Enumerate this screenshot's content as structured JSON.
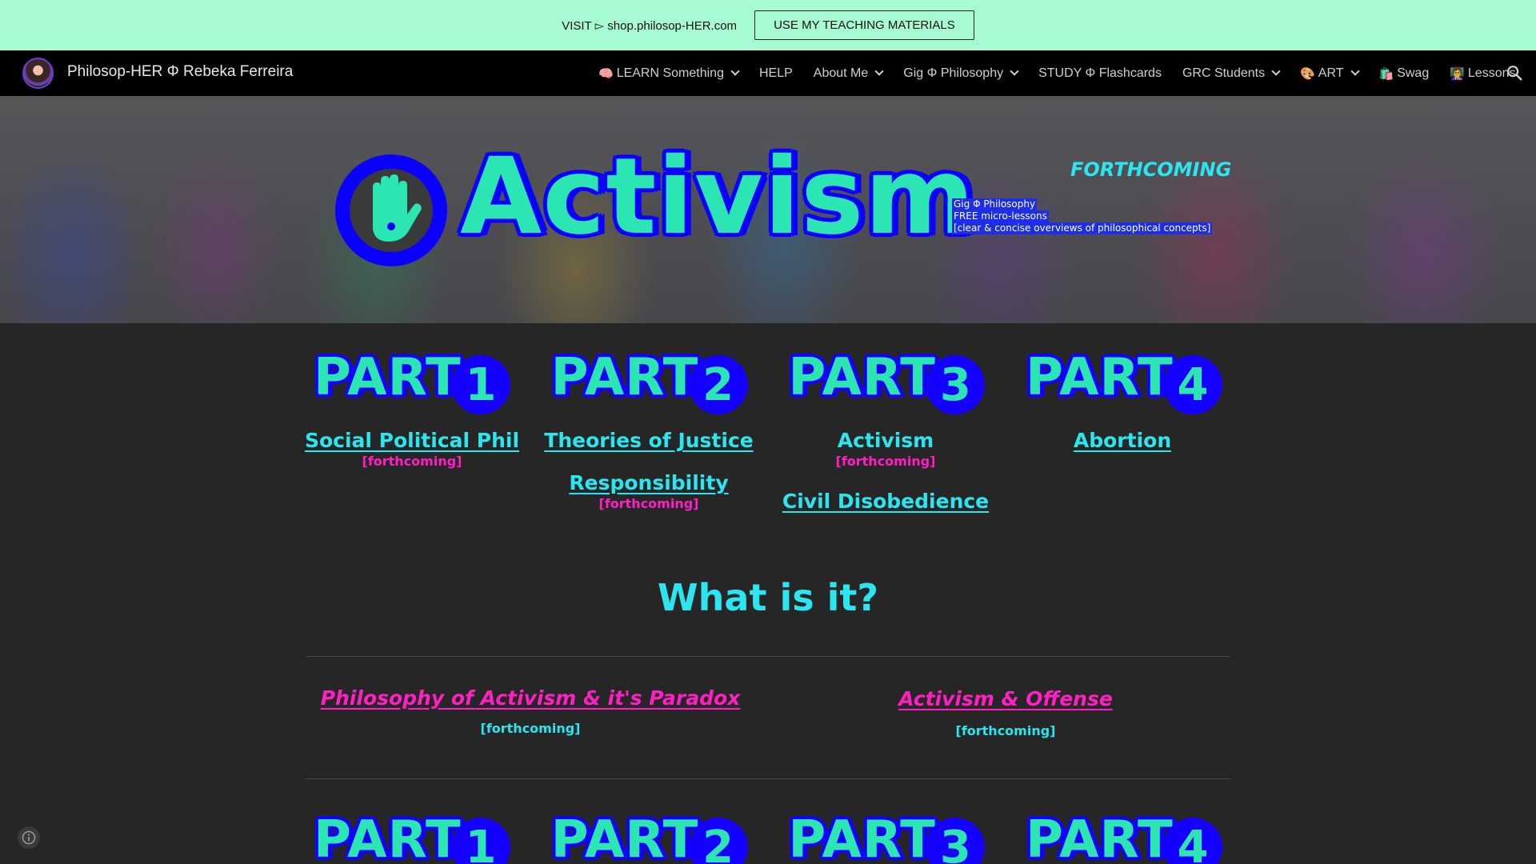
{
  "promo": {
    "text": "VISIT ▻ shop.philosop-HER.com",
    "button_label": "USE MY TEACHING MATERIALS"
  },
  "nav": {
    "site_title": "Philosop-HER Φ Rebeka Ferreira",
    "items": [
      {
        "emoji": "🧠",
        "label": "LEARN Something",
        "dropdown": true
      },
      {
        "emoji": "",
        "label": "HELP",
        "dropdown": false
      },
      {
        "emoji": "",
        "label": "About Me",
        "dropdown": true
      },
      {
        "emoji": "",
        "label": "Gig Φ Philosophy",
        "dropdown": true
      },
      {
        "emoji": "",
        "label": "STUDY Φ Flashcards",
        "dropdown": false
      },
      {
        "emoji": "",
        "label": "GRC Students",
        "dropdown": true
      },
      {
        "emoji": "🎨",
        "label": "ART",
        "dropdown": true
      },
      {
        "emoji": "🛍️",
        "label": "Swag",
        "dropdown": false
      },
      {
        "emoji": "👩‍🏫",
        "label": "Lessons",
        "dropdown": false
      }
    ]
  },
  "hero": {
    "title": "Activism",
    "forthcoming": "FORTHCOMING",
    "desc_line1": "Gig Φ Philosophy",
    "desc_line2": "FREE micro-lessons",
    "desc_line3": "[clear & concise overviews of philosophical concepts]"
  },
  "parts": {
    "word": "PART",
    "numbers": [
      "1",
      "2",
      "3",
      "4"
    ]
  },
  "columns": {
    "part1": {
      "link": "Social Political Phil",
      "note": "[forthcoming]"
    },
    "part2": {
      "link1": "Theories of Justice",
      "link2": "Responsibility",
      "note2": "[forthcoming]"
    },
    "part3": {
      "title": "Activism",
      "note": "[forthcoming]",
      "link": "Civil Disobedience"
    },
    "part4": {
      "link": "Abortion"
    }
  },
  "section": {
    "heading": "What is it?",
    "left_link": "Philosophy of Activism & it's Paradox",
    "left_note": "[forthcoming]",
    "right_link": "Activism & Offense",
    "right_note": "[forthcoming]"
  },
  "colors": {
    "accent_cyan": "#2be6f0",
    "accent_green": "#2be6b2",
    "accent_blue": "#1400ff",
    "accent_pink": "#ff1fc3",
    "promo_bg": "#a7fbd2"
  }
}
